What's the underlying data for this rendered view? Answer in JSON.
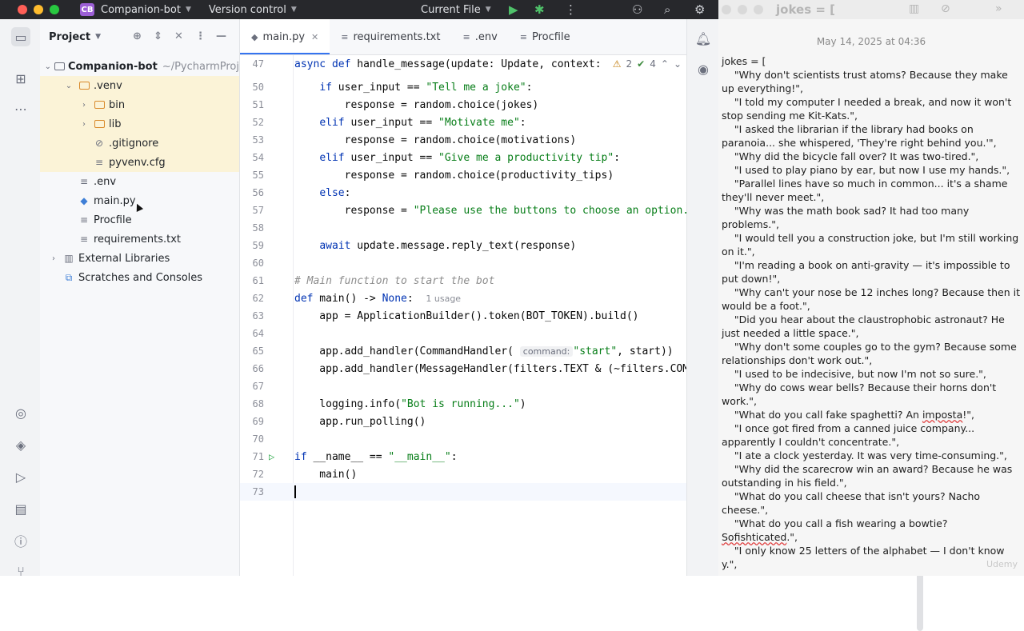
{
  "titlebar": {
    "project_badge": "CB",
    "project_name": "Companion-bot",
    "vcs": "Version control",
    "run_config": "Current File"
  },
  "project_panel": {
    "title": "Project",
    "tree": [
      {
        "label": "Companion-bot",
        "suffix": "~/PycharmProj",
        "indent": 0,
        "arrow": "open",
        "icon": "folder"
      },
      {
        "label": ".venv",
        "suffix": "",
        "indent": 1,
        "arrow": "open",
        "icon": "folder-venv"
      },
      {
        "label": "bin",
        "suffix": "",
        "indent": 2,
        "arrow": "closed",
        "icon": "folder-venv"
      },
      {
        "label": "lib",
        "suffix": "",
        "indent": 2,
        "arrow": "closed",
        "icon": "folder-venv"
      },
      {
        "label": ".gitignore",
        "suffix": "",
        "indent": 2,
        "arrow": "none",
        "icon": "ignore"
      },
      {
        "label": "pyvenv.cfg",
        "suffix": "",
        "indent": 2,
        "arrow": "none",
        "icon": "lines"
      },
      {
        "label": ".env",
        "suffix": "",
        "indent": 1,
        "arrow": "none",
        "icon": "lines"
      },
      {
        "label": "main.py",
        "suffix": "",
        "indent": 1,
        "arrow": "none",
        "icon": "python"
      },
      {
        "label": "Procfile",
        "suffix": "",
        "indent": 1,
        "arrow": "none",
        "icon": "lines"
      },
      {
        "label": "requirements.txt",
        "suffix": "",
        "indent": 1,
        "arrow": "none",
        "icon": "lines"
      },
      {
        "label": "External Libraries",
        "suffix": "",
        "indent": 0,
        "arrow": "closed",
        "icon": "library"
      },
      {
        "label": "Scratches and Consoles",
        "suffix": "",
        "indent": 0,
        "arrow": "none",
        "icon": "scratch"
      }
    ]
  },
  "tabs": [
    {
      "label": "main.py",
      "active": true
    },
    {
      "label": "requirements.txt",
      "active": false
    },
    {
      "label": ".env",
      "active": false
    },
    {
      "label": "Procfile",
      "active": false
    }
  ],
  "editor": {
    "inspection": {
      "warnings": "2",
      "checks": "4"
    },
    "lines": [
      {
        "n": "47",
        "text": "async def handle_message(update: Update, context:"
      },
      {
        "n": "50",
        "text": "    if user_input == \"Tell me a joke\":"
      },
      {
        "n": "51",
        "text": "        response = random.choice(jokes)"
      },
      {
        "n": "52",
        "text": "    elif user_input == \"Motivate me\":"
      },
      {
        "n": "53",
        "text": "        response = random.choice(motivations)"
      },
      {
        "n": "54",
        "text": "    elif user_input == \"Give me a productivity tip\":"
      },
      {
        "n": "55",
        "text": "        response = random.choice(productivity_tips)"
      },
      {
        "n": "56",
        "text": "    else:"
      },
      {
        "n": "57",
        "text": "        response = \"Please use the buttons to choose an option."
      },
      {
        "n": "58",
        "text": ""
      },
      {
        "n": "59",
        "text": "    await update.message.reply_text(response)"
      },
      {
        "n": "60",
        "text": ""
      },
      {
        "n": "61",
        "text": "# Main function to start the bot"
      },
      {
        "n": "62",
        "text": "def main() -> None:"
      },
      {
        "n": "63",
        "text": "    app = ApplicationBuilder().token(BOT_TOKEN).build()"
      },
      {
        "n": "64",
        "text": ""
      },
      {
        "n": "65",
        "text": "    app.add_handler(CommandHandler(\"start\", start))"
      },
      {
        "n": "66",
        "text": "    app.add_handler(MessageHandler(filters.TEXT & (~filters.COM"
      },
      {
        "n": "67",
        "text": ""
      },
      {
        "n": "68",
        "text": "    logging.info(\"Bot is running...\")"
      },
      {
        "n": "69",
        "text": "    app.run_polling()"
      },
      {
        "n": "70",
        "text": ""
      },
      {
        "n": "71",
        "text": "if __name__ == \"__main__\":"
      },
      {
        "n": "72",
        "text": "    main()"
      },
      {
        "n": "73",
        "text": ""
      }
    ],
    "hints": {
      "usage": "1 usage",
      "command_param": "command:"
    }
  },
  "notes": {
    "title": "jokes = [",
    "date": "May 14, 2025 at 04:36",
    "lines": [
      "jokes = [",
      "    \"Why don't scientists trust atoms? Because they make up everything!\",",
      "    \"I told my computer I needed a break, and now it won't stop sending me Kit-Kats.\",",
      "    \"I asked the librarian if the library had books on paranoia... she whispered, 'They're right behind you.'\",",
      "    \"Why did the bicycle fall over? It was two-tired.\",",
      "    \"I used to play piano by ear, but now I use my hands.\",",
      "    \"Parallel lines have so much in common... it's a shame they'll never meet.\",",
      "    \"Why was the math book sad? It had too many problems.\",",
      "    \"I would tell you a construction joke, but I'm still working on it.\",",
      "    \"I'm reading a book on anti-gravity — it's impossible to put down!\",",
      "    \"Why can't your nose be 12 inches long? Because then it would be a foot.\",",
      "    \"Did you hear about the claustrophobic astronaut? He just needed a little space.\",",
      "    \"Why don't some couples go to the gym? Because some relationships don't work out.\",",
      "    \"I used to be indecisive, but now I'm not so sure.\",",
      "    \"Why do cows wear bells? Because their horns don't work.\",",
      "    \"What do you call fake spaghetti? An imposta!\",",
      "    \"I once got fired from a canned juice company... apparently I couldn't concentrate.\",",
      "    \"I ate a clock yesterday. It was very time-consuming.\",",
      "    \"Why did the scarecrow win an award? Because he was outstanding in his field.\",",
      "    \"What do you call cheese that isn't yours? Nacho cheese.\",",
      "    \"What do you call a fish wearing a bowtie? Sofishticated.\",",
      "    \"I only know 25 letters of the alphabet — I don't know y.\","
    ],
    "watermark": "Udemy"
  }
}
